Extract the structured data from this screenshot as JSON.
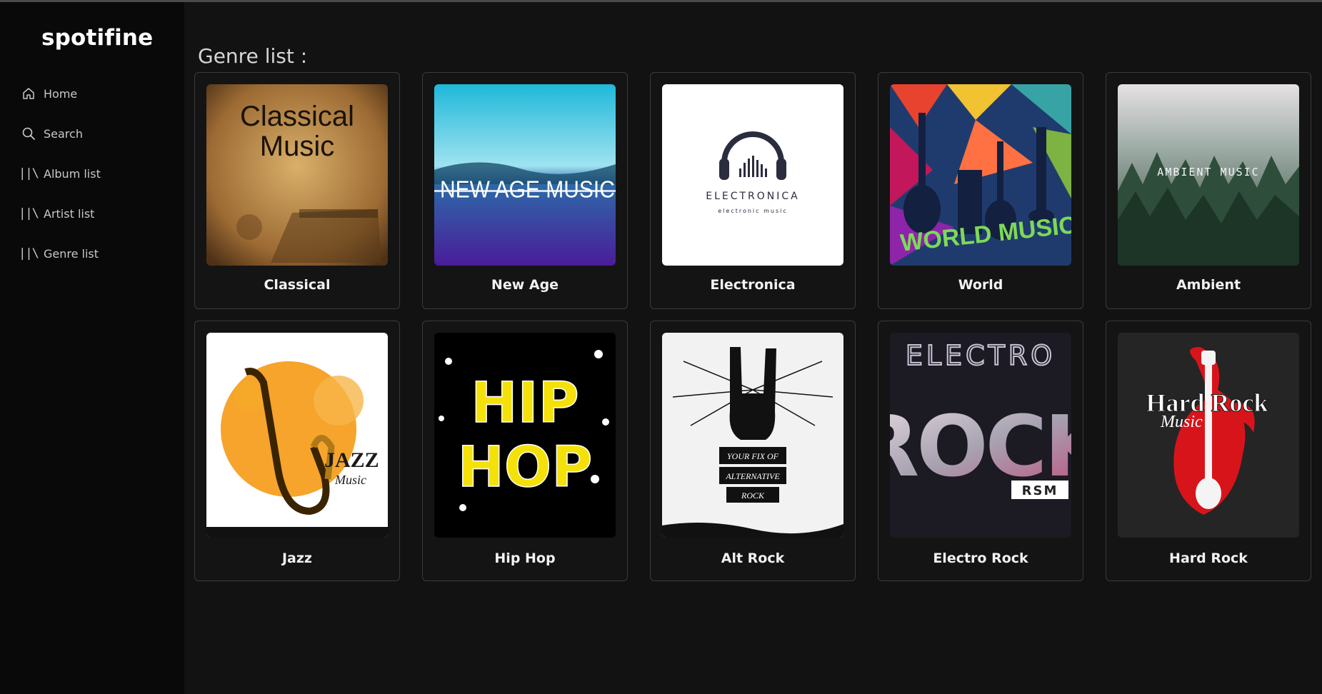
{
  "app": {
    "brand": "spotifine"
  },
  "sidebar": {
    "items": [
      {
        "label": "Home",
        "icon": "home-icon"
      },
      {
        "label": "Search",
        "icon": "search-icon"
      },
      {
        "label": "Album list",
        "icon": "library-icon"
      },
      {
        "label": "Artist list",
        "icon": "library-icon"
      },
      {
        "label": "Genre list",
        "icon": "library-icon"
      }
    ]
  },
  "main": {
    "title": "Genre list :",
    "genres": [
      {
        "name": "Classical",
        "cover_text": [
          "Classical",
          "Music"
        ]
      },
      {
        "name": "New Age",
        "cover_text": [
          "NEW AGE MUSIC"
        ]
      },
      {
        "name": "Electronica",
        "cover_text": [
          "ELECTRONICA",
          "electronic music"
        ]
      },
      {
        "name": "World",
        "cover_text": [
          "WORLD MUSIC"
        ]
      },
      {
        "name": "Ambient",
        "cover_text": [
          "AMBIENT MUSIC"
        ]
      },
      {
        "name": "Jazz",
        "cover_text": [
          "JAZZ",
          "Music"
        ]
      },
      {
        "name": "Hip Hop",
        "cover_text": [
          "HIP",
          "HOP"
        ]
      },
      {
        "name": "Alt Rock",
        "cover_text": [
          "YOUR FIX OF",
          "ALTERNATIVE",
          "ROCK"
        ]
      },
      {
        "name": "Electro Rock",
        "cover_text": [
          "ELECTRO",
          "ROCK",
          "RSM"
        ]
      },
      {
        "name": "Hard Rock",
        "cover_text": [
          "Hard Rock",
          "Music"
        ]
      }
    ]
  },
  "colors": {
    "background": "#121212",
    "sidebar": "#090909",
    "card_border": "#3b3b3b",
    "text": "#f2f2f2"
  }
}
